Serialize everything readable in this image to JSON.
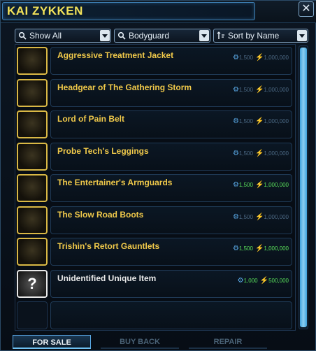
{
  "window": {
    "title": "KAI ZYKKEN",
    "close_symbol": "✕"
  },
  "filters": {
    "show": {
      "label": "Show All",
      "icon": "search-icon"
    },
    "category": {
      "label": "Bodyguard",
      "icon": "search-icon"
    },
    "sort": {
      "label": "Sort by Name",
      "icon": "sort-icon"
    }
  },
  "items": [
    {
      "name": "Aggressive Treatment Jacket",
      "currency1": "1,500",
      "currency2": "1,000,000",
      "affordable": false,
      "icon": "jacket-icon"
    },
    {
      "name": "Headgear of The Gathering Storm",
      "currency1": "1,500",
      "currency2": "1,000,000",
      "affordable": false,
      "icon": "helmet-icon"
    },
    {
      "name": "Lord of Pain Belt",
      "currency1": "1,500",
      "currency2": "1,000,000",
      "affordable": false,
      "icon": "belt-icon"
    },
    {
      "name": "Probe Tech's Leggings",
      "currency1": "1,500",
      "currency2": "1,000,000",
      "affordable": false,
      "icon": "leggings-icon"
    },
    {
      "name": "The Entertainer's Armguards",
      "currency1": "1,500",
      "currency2": "1,000,000",
      "affordable": true,
      "icon": "armguards-icon"
    },
    {
      "name": "The Slow Road Boots",
      "currency1": "1,500",
      "currency2": "1,000,000",
      "affordable": false,
      "icon": "boots-icon"
    },
    {
      "name": "Trishin's Retort Gauntlets",
      "currency1": "1,500",
      "currency2": "1,000,000",
      "affordable": true,
      "icon": "gauntlets-icon"
    },
    {
      "name": "Unidentified Unique Item",
      "currency1": "1,000",
      "currency2": "500,000",
      "affordable": true,
      "icon": "mystery-item-icon"
    }
  ],
  "tabs": [
    {
      "label": "FOR SALE",
      "active": true
    },
    {
      "label": "BUY BACK",
      "active": false
    },
    {
      "label": "REPAIR",
      "active": false
    }
  ],
  "colors": {
    "title": "#f2e25a",
    "item_name": "#f0c94a",
    "affordable_price": "#59e05a",
    "unaffordable_price": "#4c6a85",
    "accent": "#3fa1dc"
  }
}
